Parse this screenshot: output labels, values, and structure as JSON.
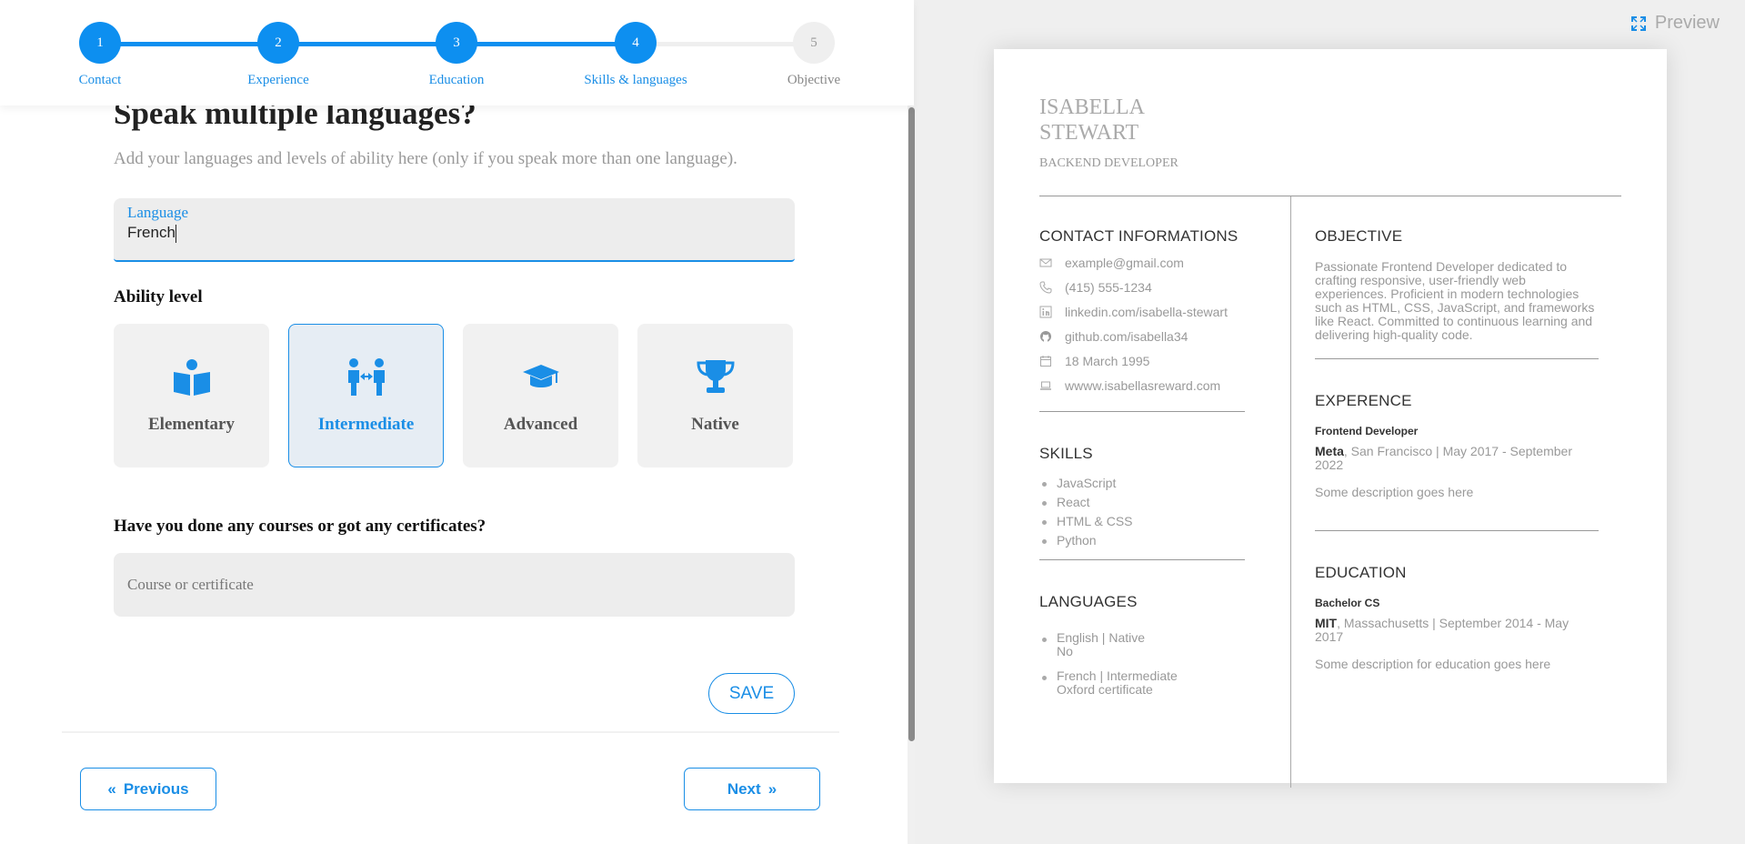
{
  "stepper": {
    "steps": [
      {
        "number": "1",
        "label": "Contact"
      },
      {
        "number": "2",
        "label": "Experience"
      },
      {
        "number": "3",
        "label": "Education"
      },
      {
        "number": "4",
        "label": "Skills & languages"
      },
      {
        "number": "5",
        "label": "Objective"
      }
    ],
    "current_step": 4,
    "colors": {
      "active": "#0d8ff0",
      "inactive": "#efefef"
    }
  },
  "form": {
    "title": "Speak multiple languages?",
    "subtitle": "Add your languages and levels of ability here (only if you speak more than one language).",
    "language_label": "Language",
    "language_value": "French",
    "ability_heading": "Ability level",
    "abilities": [
      {
        "label": "Elementary",
        "icon": "book-reader-icon",
        "selected": false
      },
      {
        "label": "Intermediate",
        "icon": "people-exchange-icon",
        "selected": true
      },
      {
        "label": "Advanced",
        "icon": "graduation-cap-icon",
        "selected": false
      },
      {
        "label": "Native",
        "icon": "trophy-icon",
        "selected": false
      }
    ],
    "course_heading": "Have you done any courses or got any certificates?",
    "course_placeholder": "Course or certificate",
    "course_value": "",
    "save_label": "SAVE"
  },
  "nav": {
    "previous_label": "Previous",
    "next_label": "Next",
    "previous_icon": "«",
    "next_icon": "»"
  },
  "preview": {
    "button_label": "Preview",
    "button_icon": "expand-icon"
  },
  "resume": {
    "name_first": "ISABELLA",
    "name_last": "STEWART",
    "role": "BACKEND DEVELOPER",
    "contact": {
      "heading": "CONTACT INFORMATIONS",
      "items": [
        {
          "icon": "mail-icon",
          "text": "example@gmail.com"
        },
        {
          "icon": "phone-icon",
          "text": "(415) 555-1234"
        },
        {
          "icon": "linkedin-icon",
          "text": "linkedin.com/isabella-stewart"
        },
        {
          "icon": "github-icon",
          "text": "github.com/isabella34"
        },
        {
          "icon": "calendar-icon",
          "text": "18 March 1995"
        },
        {
          "icon": "laptop-icon",
          "text": "wwww.isabellasreward.com"
        }
      ]
    },
    "skills": {
      "heading": "SKILLS",
      "items": [
        "JavaScript",
        "React",
        "HTML & CSS",
        "Python"
      ]
    },
    "languages": {
      "heading": "LANGUAGES",
      "items": [
        {
          "line1": "English | Native",
          "line2": "No"
        },
        {
          "line1": "French | Intermediate",
          "line2": "Oxford certificate"
        }
      ]
    },
    "objective": {
      "heading": "OBJECTIVE",
      "text": "Passionate Frontend Developer dedicated to crafting responsive, user-friendly web experiences. Proficient in modern technologies such as HTML, CSS, JavaScript, and frameworks like React. Committed to continuous learning and delivering high-quality code."
    },
    "experience": {
      "heading": "EXPERENCE",
      "title": "Frontend Developer",
      "company": "Meta",
      "details": ", San Francisco | May 2017 - September 2022",
      "description": "Some description goes here"
    },
    "education": {
      "heading": "EDUCATION",
      "degree": "Bachelor CS",
      "school": "MIT",
      "details": ", Massachusetts | September 2014 - May 2017",
      "description": "Some description for education goes here"
    }
  }
}
